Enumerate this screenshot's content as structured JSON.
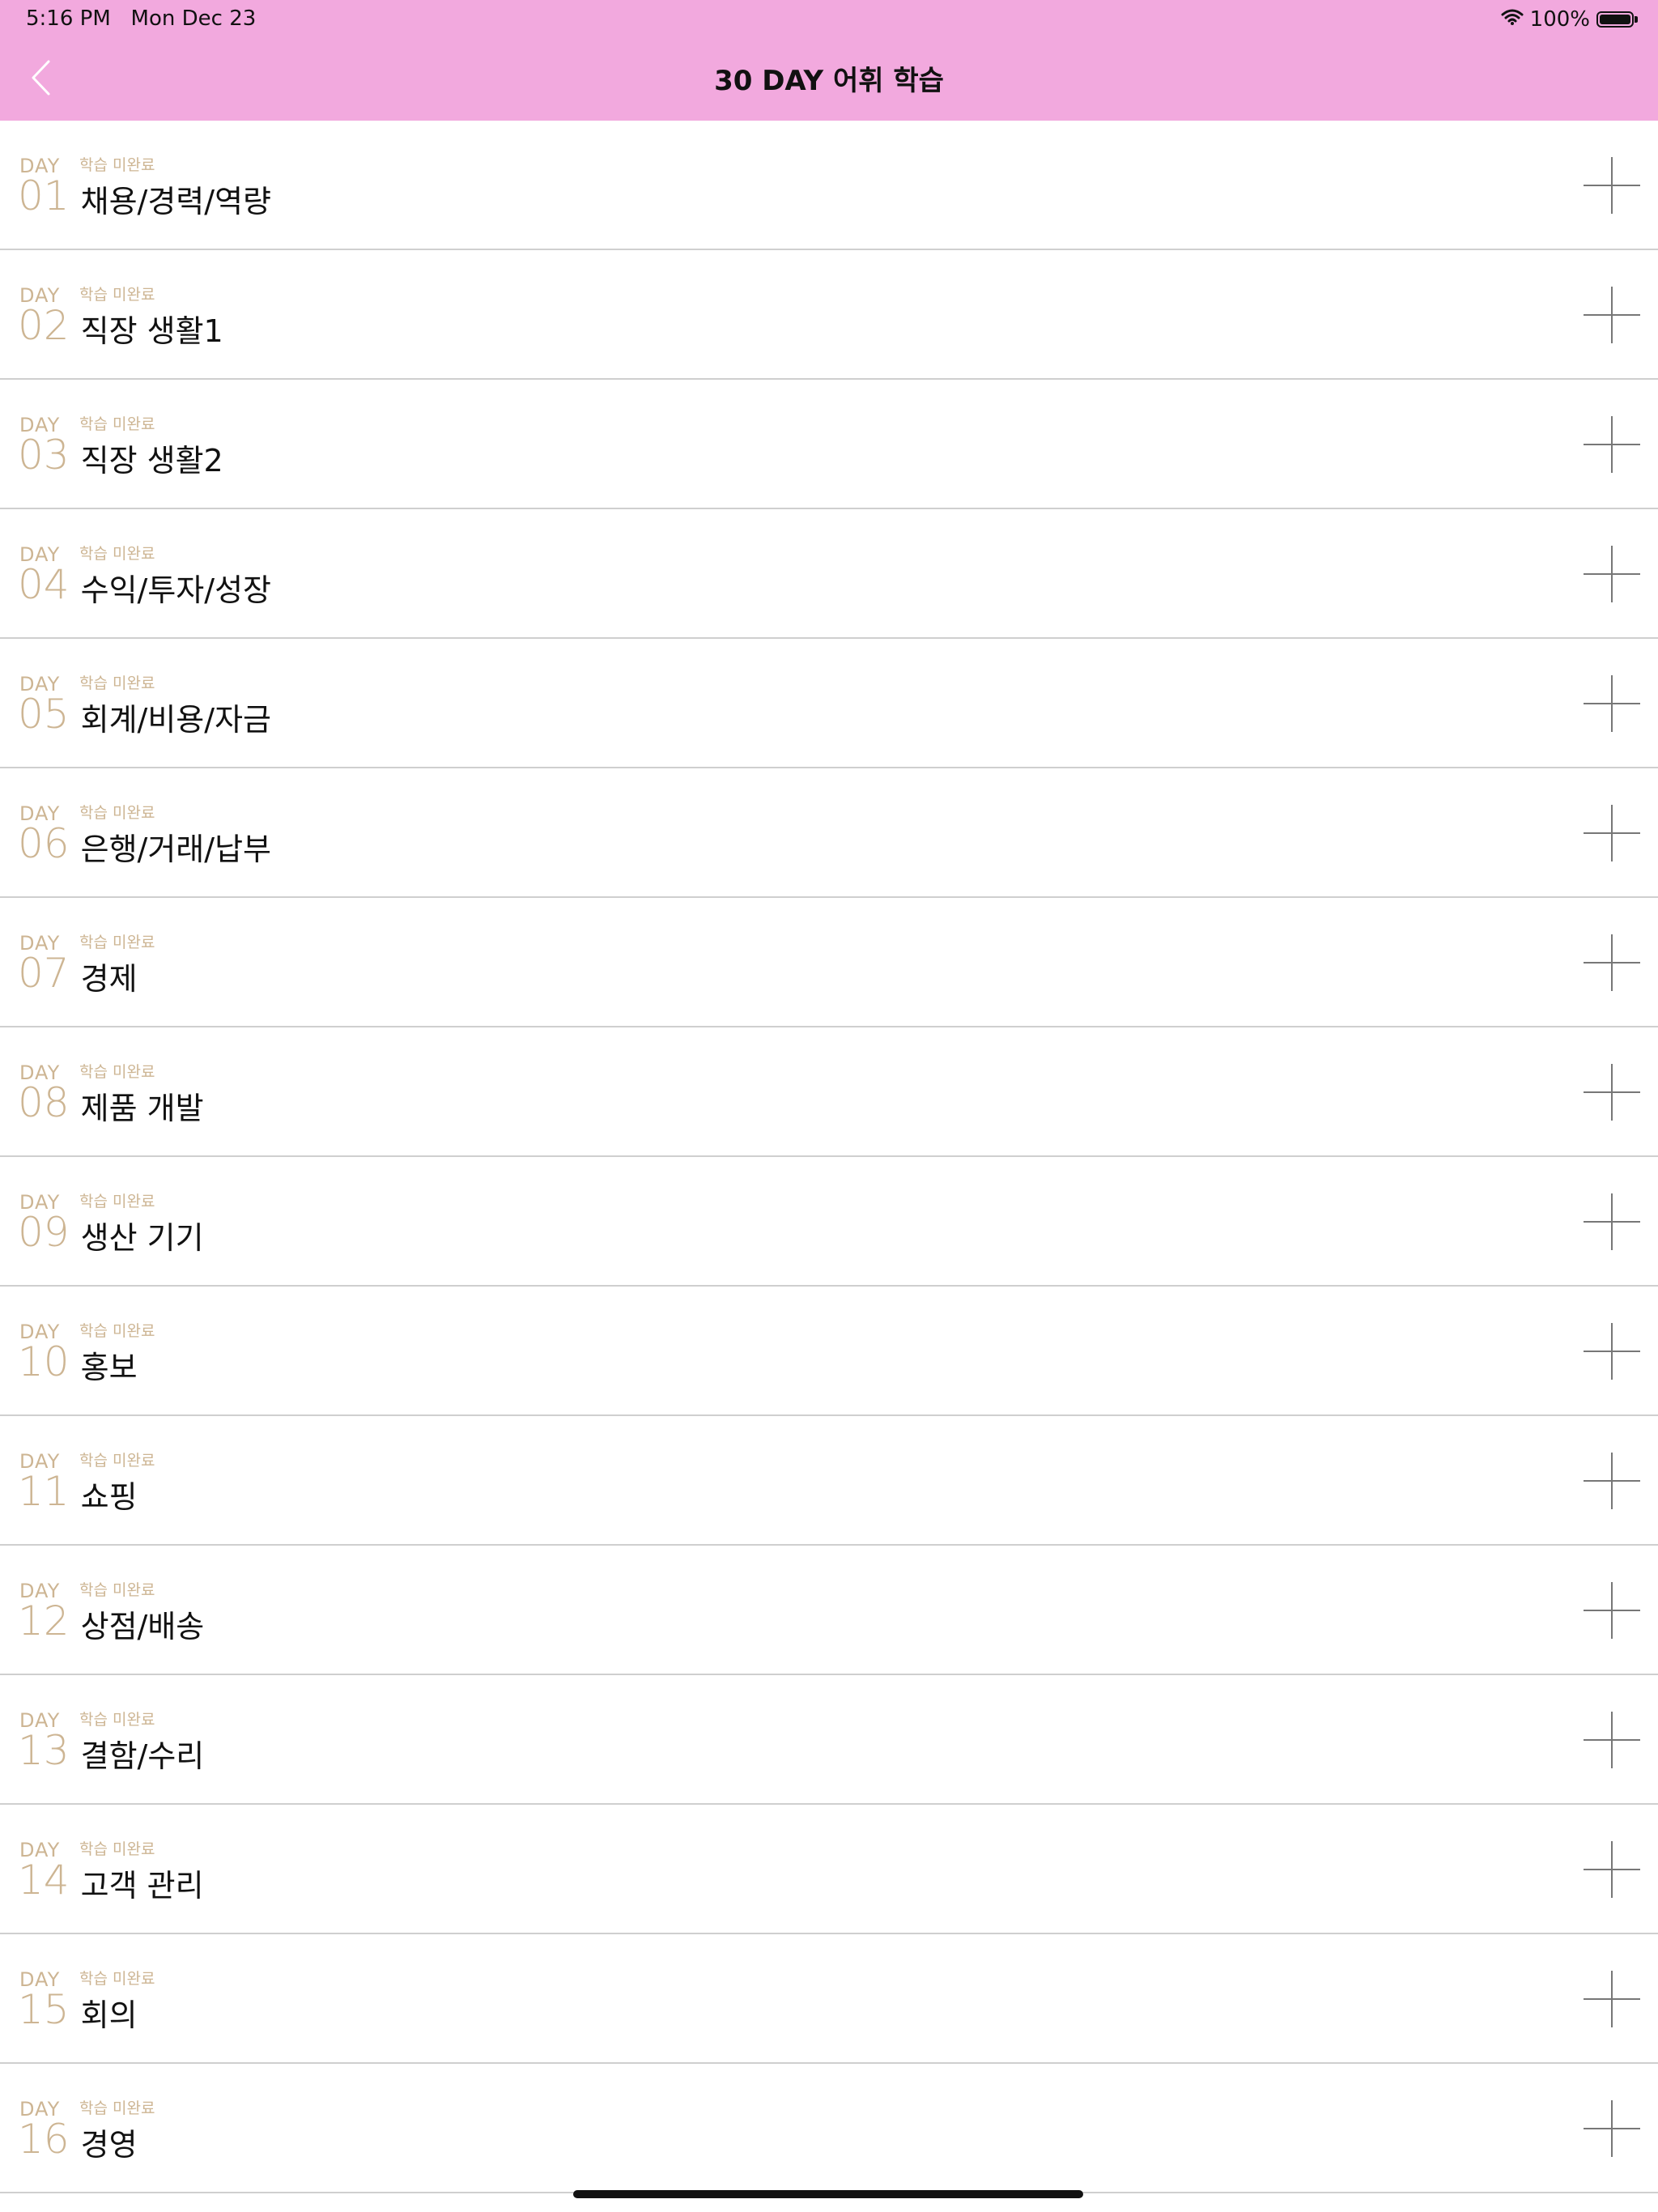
{
  "status_bar": {
    "time": "5:16 PM   Mon Dec 23",
    "battery": "100%"
  },
  "header": {
    "title": "30 DAY 어휘 학습"
  },
  "days": [
    {
      "day_label": "DAY",
      "number": "01",
      "status": "학습 미완료",
      "title": "채용/경력/역량"
    },
    {
      "day_label": "DAY",
      "number": "02",
      "status": "학습 미완료",
      "title": "직장 생활1"
    },
    {
      "day_label": "DAY",
      "number": "03",
      "status": "학습 미완료",
      "title": "직장 생활2"
    },
    {
      "day_label": "DAY",
      "number": "04",
      "status": "학습 미완료",
      "title": "수익/투자/성장"
    },
    {
      "day_label": "DAY",
      "number": "05",
      "status": "학습 미완료",
      "title": "회계/비용/자금"
    },
    {
      "day_label": "DAY",
      "number": "06",
      "status": "학습 미완료",
      "title": "은행/거래/납부"
    },
    {
      "day_label": "DAY",
      "number": "07",
      "status": "학습 미완료",
      "title": "경제"
    },
    {
      "day_label": "DAY",
      "number": "08",
      "status": "학습 미완료",
      "title": "제품 개발"
    },
    {
      "day_label": "DAY",
      "number": "09",
      "status": "학습 미완료",
      "title": "생산 기기"
    },
    {
      "day_label": "DAY",
      "number": "10",
      "status": "학습 미완료",
      "title": "홍보"
    },
    {
      "day_label": "DAY",
      "number": "11",
      "status": "학습 미완료",
      "title": "쇼핑"
    },
    {
      "day_label": "DAY",
      "number": "12",
      "status": "학습 미완료",
      "title": "상점/배송"
    },
    {
      "day_label": "DAY",
      "number": "13",
      "status": "학습 미완료",
      "title": "결함/수리"
    },
    {
      "day_label": "DAY",
      "number": "14",
      "status": "학습 미완료",
      "title": "고객 관리"
    },
    {
      "day_label": "DAY",
      "number": "15",
      "status": "학습 미완료",
      "title": "회의"
    },
    {
      "day_label": "DAY",
      "number": "16",
      "status": "학습 미완료",
      "title": "경영"
    }
  ],
  "colors": {
    "header_bg": "#f2a9de",
    "accent": "#cdb593",
    "divider": "#cfcfcf"
  },
  "icons": {
    "back": "chevron-left-icon",
    "add": "plus-icon"
  }
}
